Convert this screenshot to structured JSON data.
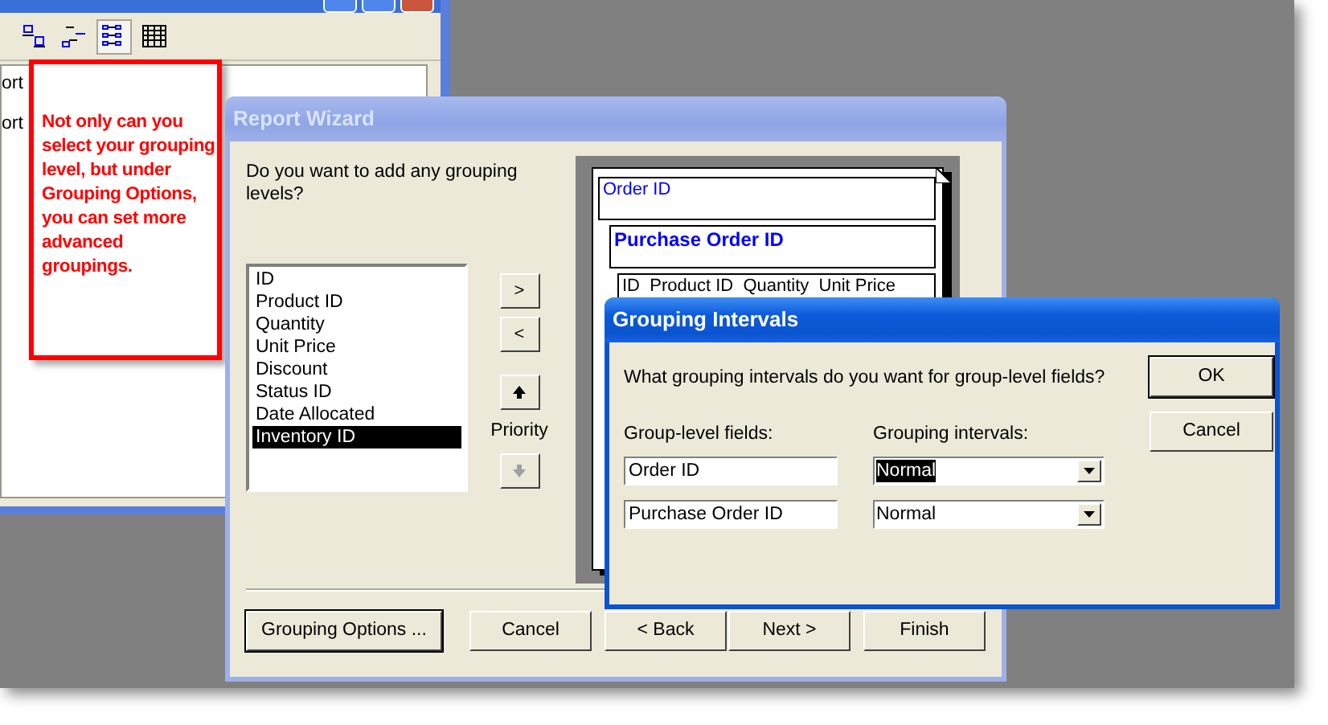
{
  "back_window": {
    "toolbar_buttons": [
      {
        "selected": false
      },
      {
        "selected": false
      },
      {
        "selected": true
      },
      {
        "selected": false
      }
    ],
    "list_items": [
      "ort",
      "ort"
    ]
  },
  "callout": {
    "text": "Not only can you select your grouping level, but under Grouping Options, you can set more advanced groupings."
  },
  "report_wizard": {
    "title": "Report Wizard",
    "question": "Do you want to add any grouping levels?",
    "fields": [
      {
        "label": "ID",
        "selected": false
      },
      {
        "label": "Product ID",
        "selected": false
      },
      {
        "label": "Quantity",
        "selected": false
      },
      {
        "label": "Unit Price",
        "selected": false
      },
      {
        "label": "Discount",
        "selected": false
      },
      {
        "label": "Status ID",
        "selected": false
      },
      {
        "label": "Date Allocated",
        "selected": false
      },
      {
        "label": "Inventory ID",
        "selected": true
      }
    ],
    "move_buttons": [
      ">",
      "<"
    ],
    "priority_label": "Priority",
    "priority_buttons": [
      {
        "kind": "up",
        "disabled": false
      },
      {
        "kind": "down",
        "disabled": true
      }
    ],
    "preview": [
      {
        "kind": "group",
        "text": "Order ID"
      },
      {
        "kind": "subgroup",
        "text": "Purchase Order ID"
      },
      {
        "kind": "detail",
        "text": "ID  Product ID  Quantity  Unit Price"
      }
    ],
    "buttons": [
      {
        "label": "Grouping Options ...",
        "default": true
      },
      {
        "label": "Cancel",
        "default": false
      },
      {
        "label": "< Back",
        "default": false
      },
      {
        "label": "Next >",
        "default": false
      },
      {
        "label": "Finish",
        "default": false
      }
    ]
  },
  "grouping_intervals": {
    "title": "Grouping Intervals",
    "question": "What grouping intervals do you want for group-level fields?",
    "fields_label": "Group-level fields:",
    "intervals_label": "Grouping intervals:",
    "rows": [
      {
        "field": "Order ID",
        "interval": "Normal",
        "selected": true
      },
      {
        "field": "Purchase Order ID",
        "interval": "Normal",
        "selected": false
      }
    ],
    "buttons": [
      {
        "label": "OK",
        "default": true
      },
      {
        "label": "Cancel",
        "default": false
      }
    ]
  }
}
